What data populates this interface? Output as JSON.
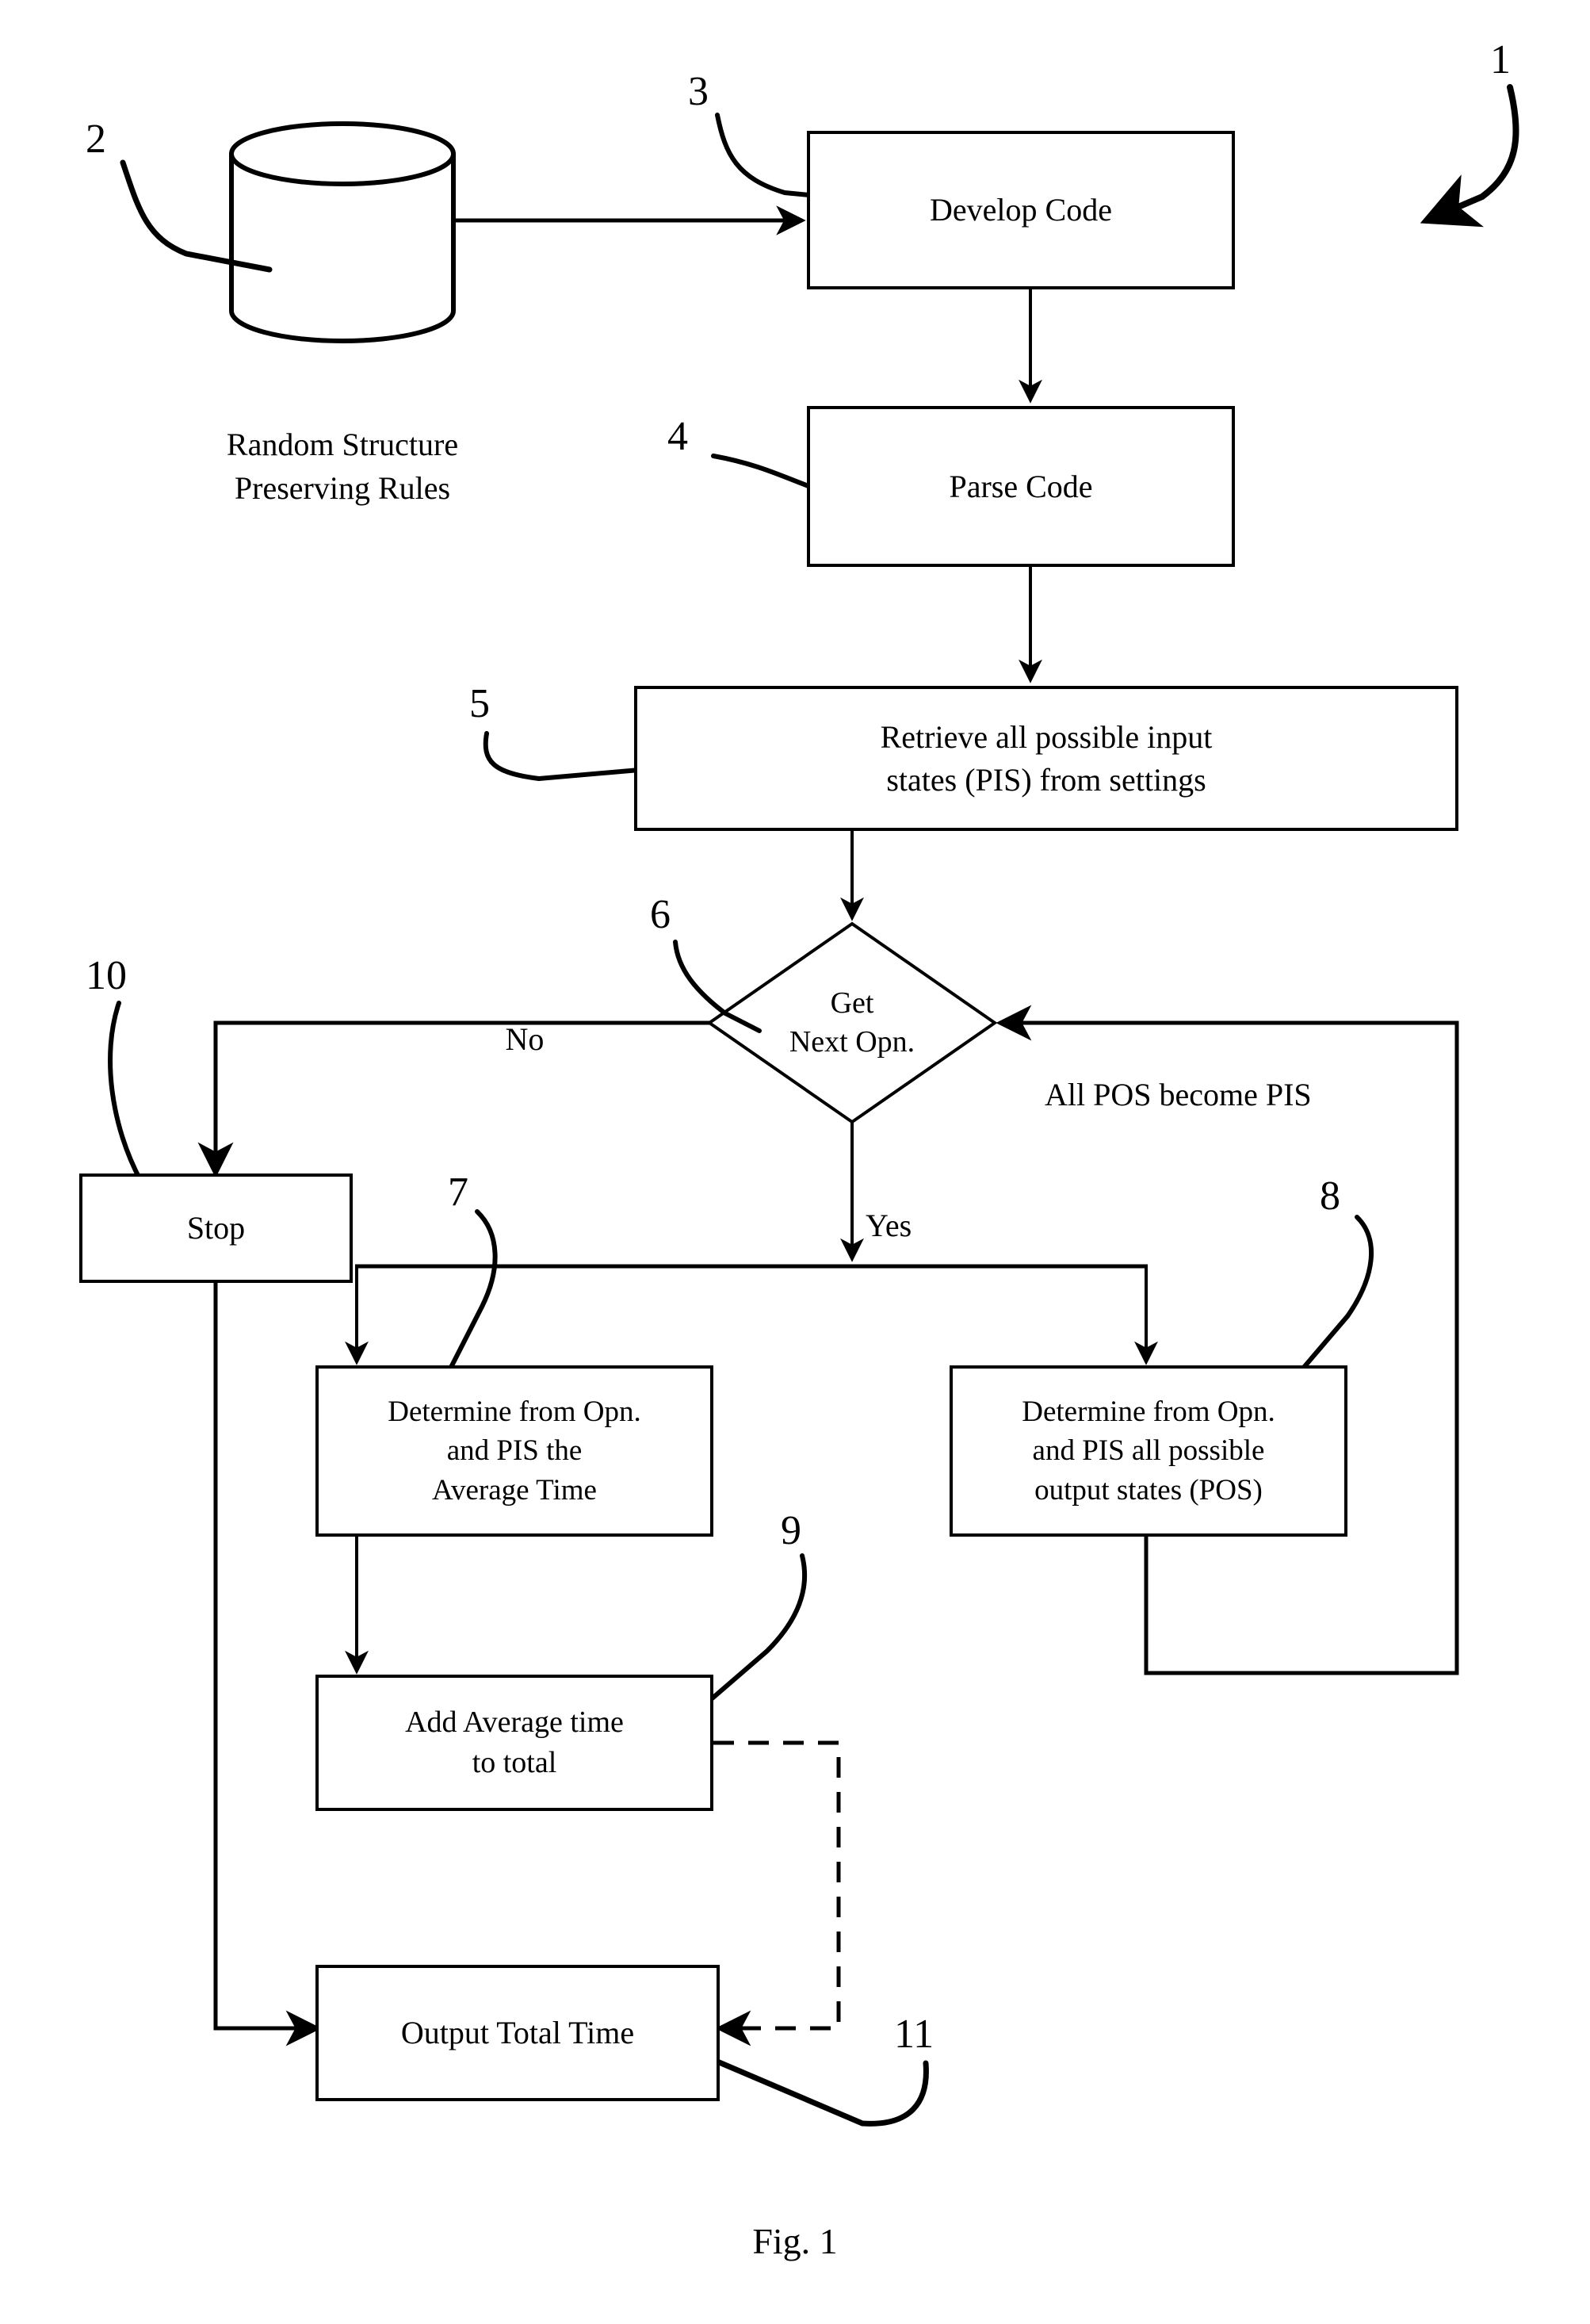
{
  "figure": {
    "caption": "Fig. 1",
    "caption_font_size": 46
  },
  "nodes": {
    "datastore": {
      "label": "Random Structure\nPreserving Rules",
      "ref": "2",
      "shape": "cylinder"
    },
    "develop_code": {
      "label": "Develop Code",
      "ref": "3",
      "shape": "process"
    },
    "parse_code": {
      "label": "Parse Code",
      "ref": "4",
      "shape": "process"
    },
    "retrieve_pis": {
      "label": "Retrieve all possible input\nstates (PIS) from settings",
      "ref": "5",
      "shape": "process"
    },
    "get_next_opn": {
      "label": "Get\nNext Opn.",
      "ref": "6",
      "shape": "decision"
    },
    "determine_avg_time": {
      "label": "Determine from Opn.\nand PIS the\nAverage Time",
      "ref": "7",
      "shape": "process"
    },
    "determine_pos": {
      "label": "Determine from Opn.\nand PIS all possible\noutput states (POS)",
      "ref": "8",
      "shape": "process"
    },
    "add_average_time": {
      "label": "Add Average time\nto total",
      "ref": "9",
      "shape": "process"
    },
    "stop": {
      "label": "Stop",
      "ref": "10",
      "shape": "process"
    },
    "output_total_time": {
      "label": "Output Total Time",
      "ref": "11",
      "shape": "process"
    }
  },
  "edge_labels": {
    "no": "No",
    "yes": "Yes",
    "feedback": "All POS become PIS"
  },
  "ref_numbers": {
    "figure": "1",
    "datastore": "2",
    "develop_code": "3",
    "parse_code": "4",
    "retrieve_pis": "5",
    "get_next_opn": "6",
    "determine_avg_time": "7",
    "determine_pos": "8",
    "add_average_time": "9",
    "stop": "10",
    "output_total_time": "11"
  },
  "style": {
    "line_color": "#000000",
    "fill_color": "#ffffff",
    "background": "#ffffff"
  }
}
